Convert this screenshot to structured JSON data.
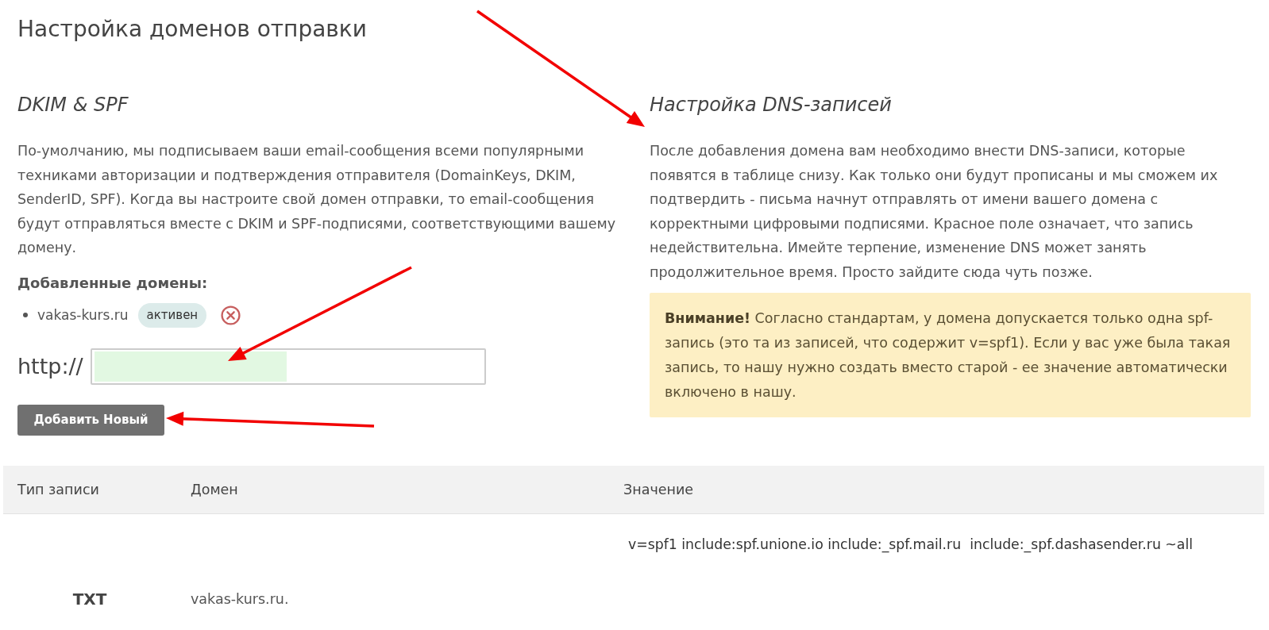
{
  "page_title": "Настройка доменов отправки",
  "dkim_section": {
    "heading": "DKIM & SPF",
    "description": "По-умолчанию, мы подписываем ваши email-сообщения всеми популярными техниками авторизации и подтверждения отправителя (DomainKeys, DKIM, SenderID, SPF). Когда вы настроите свой домен отправки, то email-сообщения будут отправляться вместе с DKIM и SPF-подписями, соответствующими вашему домену.",
    "domains_heading": "Добавленные домены:",
    "domains": [
      {
        "name": "vakas-kurs.ru",
        "status": "активен"
      }
    ],
    "domain_form": {
      "prefix": "http://",
      "highlighted": true
    },
    "add_button": "Добавить Новый"
  },
  "dns_section": {
    "heading": "Настройка DNS-записей",
    "description": "После добавления домена вам необходимо внести DNS-записи, которые появятся в таблице снизу. Как только они будут прописаны и мы сможем их подтвердить - письма начнут отправлять от имени вашего домена с корректными цифровыми подписями. Красное поле означает, что запись недействительна. Имейте терпение, изменение DNS может занять продолжительное время. Просто зайдите сюда чуть позже.",
    "alert": "**Внимание!** Согласно стандартам, у домена допускается только одна spf-запись (это та из записей, что содержит v=spf1). Если у вас уже была такая запись, то нашу нужно создать вместо старой - ее значение автоматически включено в нашу."
  },
  "dns_table": {
    "columns": [
      "Тип записи",
      "Домен",
      "Значение"
    ],
    "rows": [
      {
        "type": "TXT",
        "domain": "vakas-kurs.ru.",
        "value": "v=spf1 include:spf.unione.io include:_spf.mail.ru  include:_spf.dashasender.ru ~all"
      }
    ]
  },
  "annotations": [
    {
      "kind": "arrow"
    },
    {
      "kind": "arrow"
    },
    {
      "kind": "arrow"
    }
  ]
}
